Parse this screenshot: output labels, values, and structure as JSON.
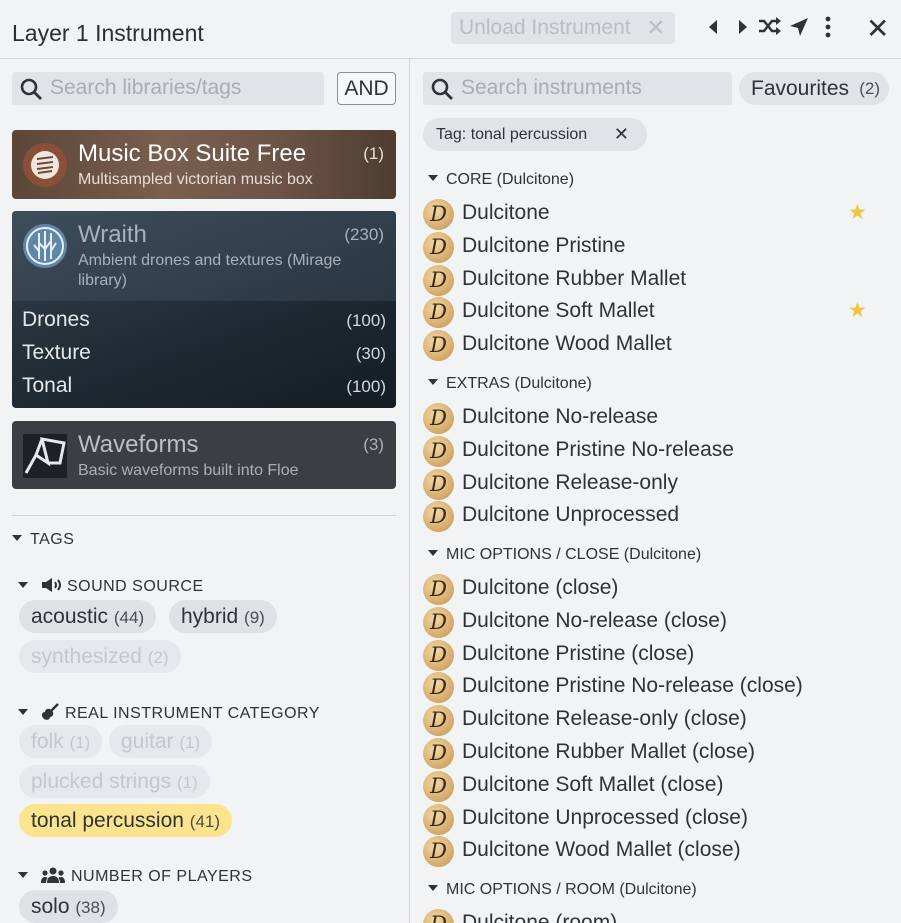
{
  "header": {
    "title": "Layer 1 Instrument",
    "unload_label": "Unload Instrument",
    "unload_close": "✕",
    "close_glyph": "✕"
  },
  "left": {
    "search_placeholder": "Search libraries/tags",
    "and_label": "AND",
    "libraries": [
      {
        "name": "Music Box Suite Free",
        "desc": "Multisampled victorian music box",
        "count": "(1)"
      },
      {
        "name": "Wraith",
        "desc": "Ambient drones and textures (Mirage library)",
        "count": "(230)",
        "subs": [
          {
            "name": "Drones",
            "count": "(100)"
          },
          {
            "name": "Texture",
            "count": "(30)"
          },
          {
            "name": "Tonal",
            "count": "(100)"
          }
        ]
      },
      {
        "name": "Waveforms",
        "desc": "Basic waveforms built into Floe",
        "count": "(3)"
      }
    ],
    "tags_title": "TAGS",
    "sound_source": {
      "title": "SOUND SOURCE",
      "tags": [
        {
          "name": "acoustic",
          "count": "(44)"
        },
        {
          "name": "hybrid",
          "count": "(9)"
        },
        {
          "name": "synthesized",
          "count": "(2)"
        }
      ]
    },
    "real_instrument": {
      "title": "REAL INSTRUMENT CATEGORY",
      "tags": [
        {
          "name": "folk",
          "count": "(1)"
        },
        {
          "name": "guitar",
          "count": "(1)"
        },
        {
          "name": "plucked strings",
          "count": "(1)"
        },
        {
          "name": "tonal percussion",
          "count": "(41)"
        }
      ]
    },
    "players": {
      "title": "NUMBER OF PLAYERS",
      "tags": [
        {
          "name": "solo",
          "count": "(38)"
        }
      ]
    }
  },
  "right": {
    "search_placeholder": "Search instruments",
    "favourites_label": "Favourites",
    "favourites_count": "(2)",
    "tag_filter": "Tag: tonal percussion",
    "tag_filter_close": "✕",
    "logo_letter": "D",
    "star_glyph": "★",
    "folders": [
      {
        "name": "CORE (Dulcitone)",
        "items": [
          "Dulcitone",
          "Dulcitone Pristine",
          "Dulcitone Rubber Mallet",
          "Dulcitone Soft Mallet",
          "Dulcitone Wood Mallet"
        ]
      },
      {
        "name": "EXTRAS (Dulcitone)",
        "items": [
          "Dulcitone No-release",
          "Dulcitone Pristine No-release",
          "Dulcitone Release-only",
          "Dulcitone Unprocessed"
        ]
      },
      {
        "name": "MIC OPTIONS / CLOSE (Dulcitone)",
        "items": [
          "Dulcitone (close)",
          "Dulcitone No-release (close)",
          "Dulcitone Pristine (close)",
          "Dulcitone Pristine No-release (close)",
          "Dulcitone Release-only (close)",
          "Dulcitone Rubber Mallet (close)",
          "Dulcitone Soft Mallet (close)",
          "Dulcitone Unprocessed (close)",
          "Dulcitone Wood Mallet (close)"
        ]
      },
      {
        "name": "MIC OPTIONS / ROOM (Dulcitone)",
        "items": [
          "Dulcitone (room)"
        ]
      }
    ],
    "favourites": [
      "Dulcitone",
      "Dulcitone Soft Mallet"
    ]
  }
}
